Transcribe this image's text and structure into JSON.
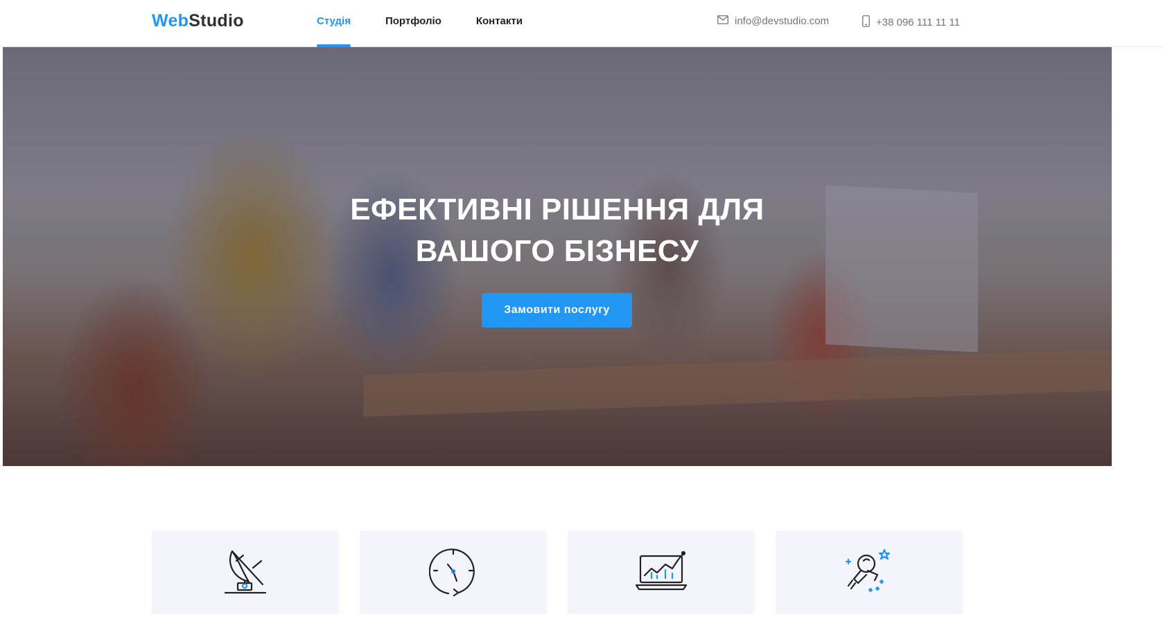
{
  "header": {
    "logo": {
      "part1": "Web",
      "part2": "Studio"
    },
    "nav": [
      {
        "label": "Студія",
        "active": true
      },
      {
        "label": "Портфоліо",
        "active": false
      },
      {
        "label": "Контакти",
        "active": false
      }
    ],
    "email": {
      "icon": "mail-icon",
      "text": "info@devstudio.com"
    },
    "phone": {
      "icon": "phone-icon",
      "text": "+38 096 111 11 11"
    }
  },
  "hero": {
    "title_line1": "ЕФЕКТИВНІ РІШЕННЯ ДЛЯ",
    "title_line2": "ВАШОГО БІЗНЕСУ",
    "cta_label": "Замовити послугу"
  },
  "features": [
    {
      "icon": "satellite-dish-icon"
    },
    {
      "icon": "clock-icon"
    },
    {
      "icon": "laptop-chart-icon"
    },
    {
      "icon": "astronaut-icon"
    }
  ],
  "colors": {
    "accent": "#2196f3",
    "text_dark": "#212121",
    "text_muted": "#757575",
    "card_bg": "#f4f4fd"
  }
}
